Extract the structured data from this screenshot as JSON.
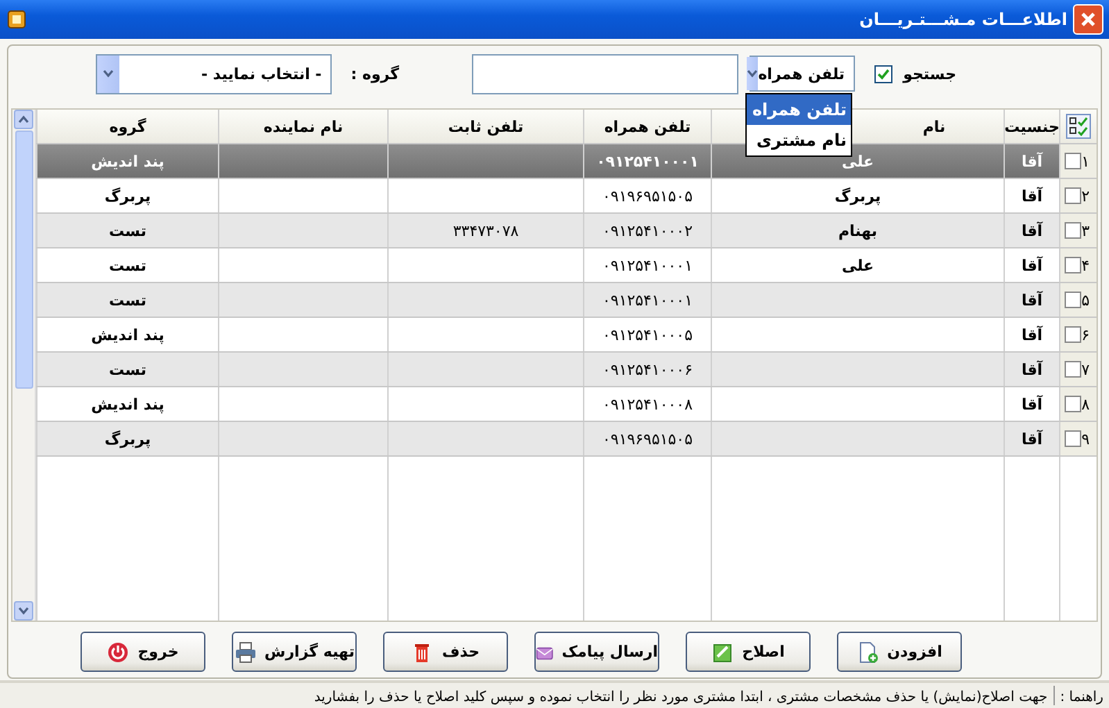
{
  "window": {
    "title": "اطلاعـــات مـشـــتـریـــان"
  },
  "search": {
    "label": "جستجو",
    "checked": true,
    "field": {
      "value": "تلفن همراه",
      "expanded": true,
      "options": [
        {
          "label": "تلفن همراه",
          "selected": true
        },
        {
          "label": "نام مشتری",
          "selected": false
        }
      ]
    },
    "group_label": "گروه :",
    "group_value": "- انتخاب نمایید -"
  },
  "table": {
    "columns": [
      "جنسیت",
      "نام",
      "تلفن همراه",
      "تلفن ثابت",
      "نام نماینده",
      "گروه"
    ],
    "rows": [
      {
        "number": "۱",
        "checked": false,
        "selected": true,
        "cells": [
          "آقا",
          "علی",
          "۰۹۱۲۵۴۱۰۰۰۱",
          "",
          "",
          "پند اندیش"
        ]
      },
      {
        "number": "۲",
        "checked": false,
        "selected": false,
        "cells": [
          "آقا",
          "پربرگ",
          "۰۹۱۹۶۹۵۱۵۰۵",
          "",
          "",
          "پربرگ"
        ]
      },
      {
        "number": "۳",
        "checked": false,
        "selected": false,
        "cells": [
          "آقا",
          "بهنام",
          "۰۹۱۲۵۴۱۰۰۰۲",
          "۳۳۴۷۳۰۷۸",
          "",
          "تست"
        ]
      },
      {
        "number": "۴",
        "checked": false,
        "selected": false,
        "cells": [
          "آقا",
          "علی",
          "۰۹۱۲۵۴۱۰۰۰۱",
          "",
          "",
          "تست"
        ]
      },
      {
        "number": "۵",
        "checked": false,
        "selected": false,
        "cells": [
          "آقا",
          "",
          "۰۹۱۲۵۴۱۰۰۰۱",
          "",
          "",
          "تست"
        ]
      },
      {
        "number": "۶",
        "checked": false,
        "selected": false,
        "cells": [
          "آقا",
          "",
          "۰۹۱۲۵۴۱۰۰۰۵",
          "",
          "",
          "پند اندیش"
        ]
      },
      {
        "number": "۷",
        "checked": false,
        "selected": false,
        "cells": [
          "آقا",
          "",
          "۰۹۱۲۵۴۱۰۰۰۶",
          "",
          "",
          "تست"
        ]
      },
      {
        "number": "۸",
        "checked": false,
        "selected": false,
        "cells": [
          "آقا",
          "",
          "۰۹۱۲۵۴۱۰۰۰۸",
          "",
          "",
          "پند اندیش"
        ]
      },
      {
        "number": "۹",
        "checked": false,
        "selected": false,
        "cells": [
          "آقا",
          "",
          "۰۹۱۹۶۹۵۱۵۰۵",
          "",
          "",
          "پربرگ"
        ]
      }
    ]
  },
  "buttons": [
    {
      "label": "افزودن"
    },
    {
      "label": "اصلاح"
    },
    {
      "label": "ارسال پیامک"
    },
    {
      "label": "حذف"
    },
    {
      "label": "تهیه گزارش"
    },
    {
      "label": "خروج"
    }
  ],
  "status_bar": {
    "label": "راهنما :",
    "message": "جهت اصلاح(نمایش) یا حذف  مشخصات مشتری ، ابتدا مشتری مورد نظر را انتخاب نموده و سپس کلید اصلاح یا حذف را بفشارید"
  }
}
